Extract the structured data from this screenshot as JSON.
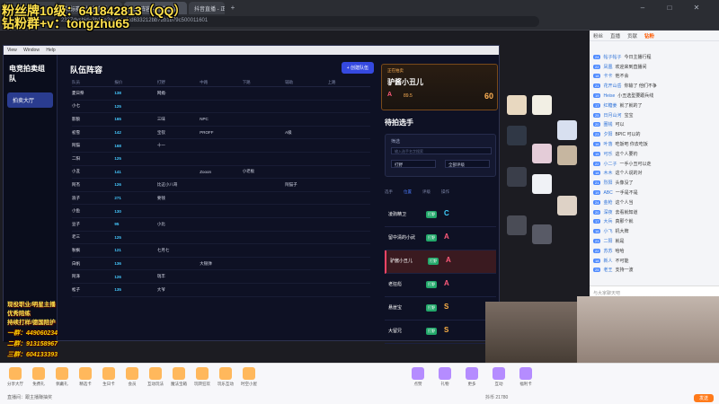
{
  "browser": {
    "tabs": [
      "新标签页",
      "锦标赛 - 抖音直播",
      "队伍阵容 - 抖音直播",
      "抖音直播 - 正在直播"
    ],
    "address": "2327dyshid=3b18a2e-dacefcd633212bb72b1b79c500011601",
    "new_tab_icon": "plus-icon"
  },
  "overlay": {
    "line1": "粉丝牌10级：641842813（QQ）",
    "line2": "钻粉群+v：tongzhu65",
    "mid1": "现役职业/明星主播",
    "mid2": "优秀陪练",
    "mid3": "持续打样/德国陪护",
    "qq1": "一群：449060234",
    "qq2": "二群：913158967",
    "qq3": "三群：604133393"
  },
  "app": {
    "menu": [
      "View",
      "Window",
      "Help"
    ],
    "brand": "电竞拍卖组队",
    "sidebar_item": "拍卖大厅",
    "roster_title": "队伍阵容",
    "add_btn": "+ 创建队伍",
    "grid_headers": [
      "队员",
      "报价",
      "打野",
      "中路",
      "下路",
      "辅助",
      "上路"
    ],
    "rows": [
      {
        "name": "夏日祭",
        "price": "138",
        "c1": "网瘾·",
        "c2": "",
        "c3": "",
        "c4": ""
      },
      {
        "name": "小七",
        "price": "125",
        "c1": "",
        "c2": "",
        "c3": "",
        "c4": ""
      },
      {
        "name": "影狼",
        "price": "165",
        "c1": "三味",
        "c2": "NPC",
        "c3": "",
        "c4": ""
      },
      {
        "name": "初雪",
        "price": "142",
        "c1": "宝钗",
        "c2": "PROFF",
        "c3": "",
        "c4": "A级"
      },
      {
        "name": "阿猫",
        "price": "168",
        "c1": "十一",
        "c2": "",
        "c3": "",
        "c4": ""
      },
      {
        "name": "二阳",
        "price": "125",
        "c1": "",
        "c2": "",
        "c3": "",
        "c4": ""
      },
      {
        "name": "小丑",
        "price": "141",
        "c1": "",
        "c2": "Zooon",
        "c3": "小老板",
        "c4": ""
      },
      {
        "name": "阿杰",
        "price": "126",
        "c1": "比这小八哥",
        "c2": "",
        "c3": "",
        "c4": "阿猫子"
      },
      {
        "name": "浪子",
        "price": "271",
        "c1": "要钱",
        "c2": "",
        "c3": "",
        "c4": ""
      },
      {
        "name": "小鱼",
        "price": "130",
        "c1": "",
        "c2": "",
        "c3": "",
        "c4": ""
      },
      {
        "name": "豆子",
        "price": "95",
        "c1": "小比",
        "c2": "",
        "c3": "",
        "c4": ""
      },
      {
        "name": "老三",
        "price": "125",
        "c1": "",
        "c2": "",
        "c3": "",
        "c4": ""
      },
      {
        "name": "秋枫",
        "price": "121",
        "c1": "七月七",
        "c2": "",
        "c3": "",
        "c4": ""
      },
      {
        "name": "白帆",
        "price": "136",
        "c1": "",
        "c2": "大银弹",
        "c3": "",
        "c4": ""
      },
      {
        "name": "阿泽",
        "price": "126",
        "c1": "瑞丰",
        "c2": "",
        "c3": "",
        "c4": ""
      },
      {
        "name": "松子",
        "price": "135",
        "c1": "大爷",
        "c2": "",
        "c3": "",
        "c4": ""
      }
    ],
    "bid_label": "正在拍卖",
    "bid_name": "驴酱小丑儿",
    "bid_price": "60",
    "bid_grade": "A",
    "bid_score": "89.5",
    "pending_title": "待拍选手",
    "filter_label": "筛选",
    "search_placeholder": "输入选手名字搜索",
    "select1": "打野",
    "select2": "全部评级",
    "tabs": [
      "选手",
      "位置",
      "评级",
      "操作"
    ],
    "players": [
      {
        "name": "凌驹精卫",
        "badge": "打野",
        "grade": "C",
        "color": "#3fd0ff"
      },
      {
        "name": "留中清的小武",
        "badge": "打野",
        "grade": "A",
        "color": "#ff5a7a"
      },
      {
        "name": "驴酱小丑儿",
        "badge": "打野",
        "grade": "A",
        "color": "#ff5a7a"
      },
      {
        "name": "老狂彪",
        "badge": "打野",
        "grade": "A",
        "color": "#ff5a7a"
      },
      {
        "name": "悬崖宝",
        "badge": "打野",
        "grade": "S",
        "color": "#ffb347"
      },
      {
        "name": "大留兄",
        "badge": "打野",
        "grade": "S",
        "color": "#ffb347"
      }
    ]
  },
  "chat": {
    "tabs": [
      "粉丝",
      "直播",
      "贡献",
      "钻粉"
    ],
    "messages": [
      {
        "lvl": "24",
        "user": "帖子帖子",
        "text": "今日主播行程"
      },
      {
        "lvl": "22",
        "user": "凤凰",
        "text": "欢迎来到直播间"
      },
      {
        "lvl": "18",
        "user": "卡卡",
        "text": "他不会"
      },
      {
        "lvl": "21",
        "user": "花开山岳",
        "text": "你输了 他们不争"
      },
      {
        "lvl": "19",
        "user": "Heise",
        "text": "小丑选型要跟兵线"
      },
      {
        "lvl": "17",
        "user": "红糖姜",
        "text": "就了就的了"
      },
      {
        "lvl": "25",
        "user": "日月山河",
        "text": "宝宝"
      },
      {
        "lvl": "20",
        "user": "圈钱",
        "text": "可以"
      },
      {
        "lvl": "23",
        "user": "夕阳",
        "text": "BPIC 可以的"
      },
      {
        "lvl": "16",
        "user": "叶落",
        "text": "吃饭吧 你去吃饭"
      },
      {
        "lvl": "15",
        "user": "可乐",
        "text": "这个人要钓"
      },
      {
        "lvl": "22",
        "user": "小二子",
        "text": "一手小丑可以走"
      },
      {
        "lvl": "18",
        "user": "木木",
        "text": "这个人说的对"
      },
      {
        "lvl": "21",
        "user": "烈阳",
        "text": "头像没了"
      },
      {
        "lvl": "19",
        "user": "ABC",
        "text": "一手是不是"
      },
      {
        "lvl": "24",
        "user": "金枪",
        "text": "这个人当"
      },
      {
        "lvl": "20",
        "user": "深夜",
        "text": "去看就知道"
      },
      {
        "lvl": "17",
        "user": "大兵",
        "text": "真那个就"
      },
      {
        "lvl": "16",
        "user": "小飞",
        "text": "机大牌"
      },
      {
        "lvl": "23",
        "user": "二阳",
        "text": "就是"
      },
      {
        "lvl": "22",
        "user": "苏苏",
        "text": "哈哈"
      },
      {
        "lvl": "18",
        "user": "新人",
        "text": "不可能"
      },
      {
        "lvl": "25",
        "user": "老王",
        "text": "支持一波"
      }
    ],
    "input_placeholder": "与大家聊天吧"
  },
  "giftbar": {
    "items": [
      "分享大厅",
      "免费礼",
      "佩戴礼",
      "精选卡",
      "生日卡",
      "会员",
      "互动玩法",
      "魔法宝箱",
      "玩转狂欢",
      "玩乐互动",
      "时空小屋"
    ],
    "right_items": [
      "点赞",
      "礼物",
      "更多",
      "互动",
      "福利卡"
    ],
    "balance_label": "抖币 21780",
    "bottom_note": "直播间：跟主播赚抽奖",
    "send_label": "发送"
  }
}
